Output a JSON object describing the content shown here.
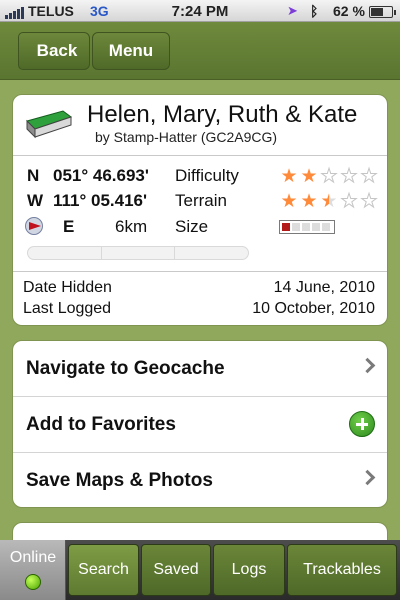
{
  "status_bar": {
    "carrier": "TELUS",
    "network": "3G",
    "time": "7:24 PM",
    "battery_percent": "62 %",
    "battery_level": 0.62,
    "icons": [
      "signal-icon",
      "location-icon",
      "bluetooth-icon",
      "battery-icon"
    ]
  },
  "nav": {
    "back_label": "Back",
    "menu_label": "Menu"
  },
  "cache": {
    "name": "Helen, Mary, Ruth & Kate",
    "byline": "by Stamp-Hatter (GC2A9CG)",
    "lat_dir": "N",
    "lat": "051° 46.693'",
    "lon_dir": "W",
    "lon": "111° 05.416'",
    "difficulty_label": "Difficulty",
    "difficulty_stars": 2,
    "terrain_label": "Terrain",
    "terrain_stars": 2.5,
    "size_label": "Size",
    "size_level": 1,
    "bearing": "E",
    "distance": "6km",
    "date_hidden_label": "Date Hidden",
    "date_hidden": "14 June, 2010",
    "last_logged_label": "Last Logged",
    "last_logged": "10 October, 2010"
  },
  "actions": [
    {
      "label": "Navigate to Geocache",
      "accessory": "chevron"
    },
    {
      "label": "Add to Favorites",
      "accessory": "plus"
    },
    {
      "label": "Save Maps & Photos",
      "accessory": "chevron"
    }
  ],
  "tabbar": {
    "online_label": "Online",
    "tabs": [
      "Search",
      "Saved",
      "Logs",
      "Trackables"
    ],
    "active_tab": "Search"
  }
}
